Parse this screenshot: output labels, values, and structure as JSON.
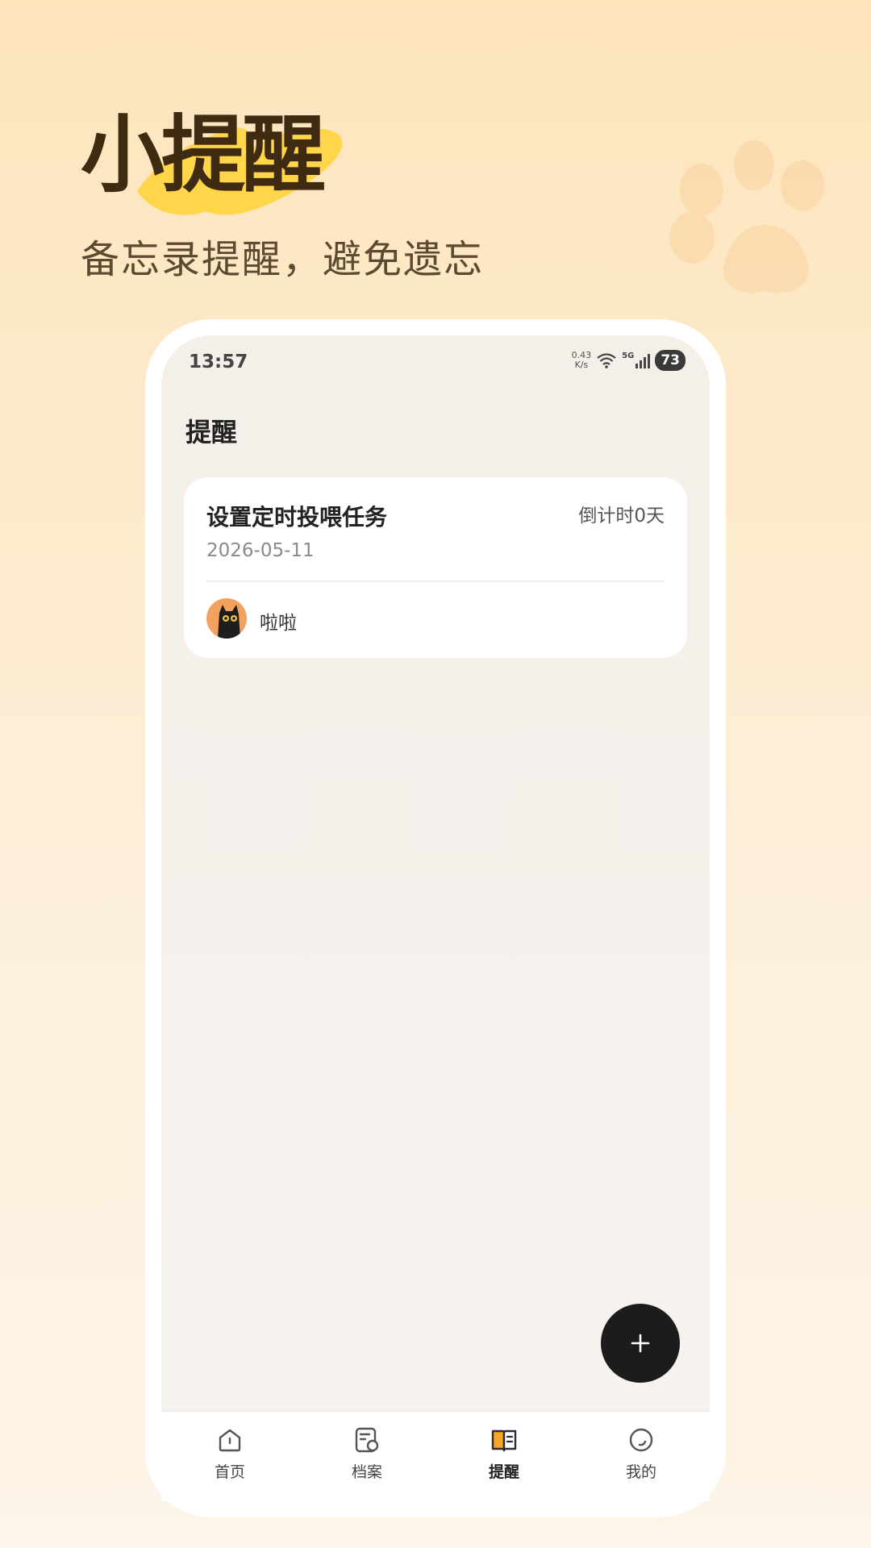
{
  "hero": {
    "title": "小提醒",
    "subtitle": "备忘录提醒，避免遗忘"
  },
  "status_bar": {
    "time": "13:57",
    "net_speed_value": "0.43",
    "net_speed_unit": "K/s",
    "network": "5G",
    "battery": "73"
  },
  "page": {
    "title": "提醒"
  },
  "reminders": [
    {
      "title": "设置定时投喂任务",
      "countdown": "倒计时0天",
      "date": "2026-05-11",
      "pet_name": "啦啦"
    }
  ],
  "fab": {
    "icon": "plus-icon"
  },
  "tabs": [
    {
      "label": "首页",
      "icon": "home-icon",
      "active": false
    },
    {
      "label": "档案",
      "icon": "profile-doc-icon",
      "active": false
    },
    {
      "label": "提醒",
      "icon": "book-icon",
      "active": true
    },
    {
      "label": "我的",
      "icon": "user-circle-icon",
      "active": false
    }
  ],
  "colors": {
    "accent_yellow": "#ffd54a",
    "title_brown": "#3f2a12",
    "fab_bg": "#1c1c1c",
    "active_tab_accent": "#f5a623"
  }
}
